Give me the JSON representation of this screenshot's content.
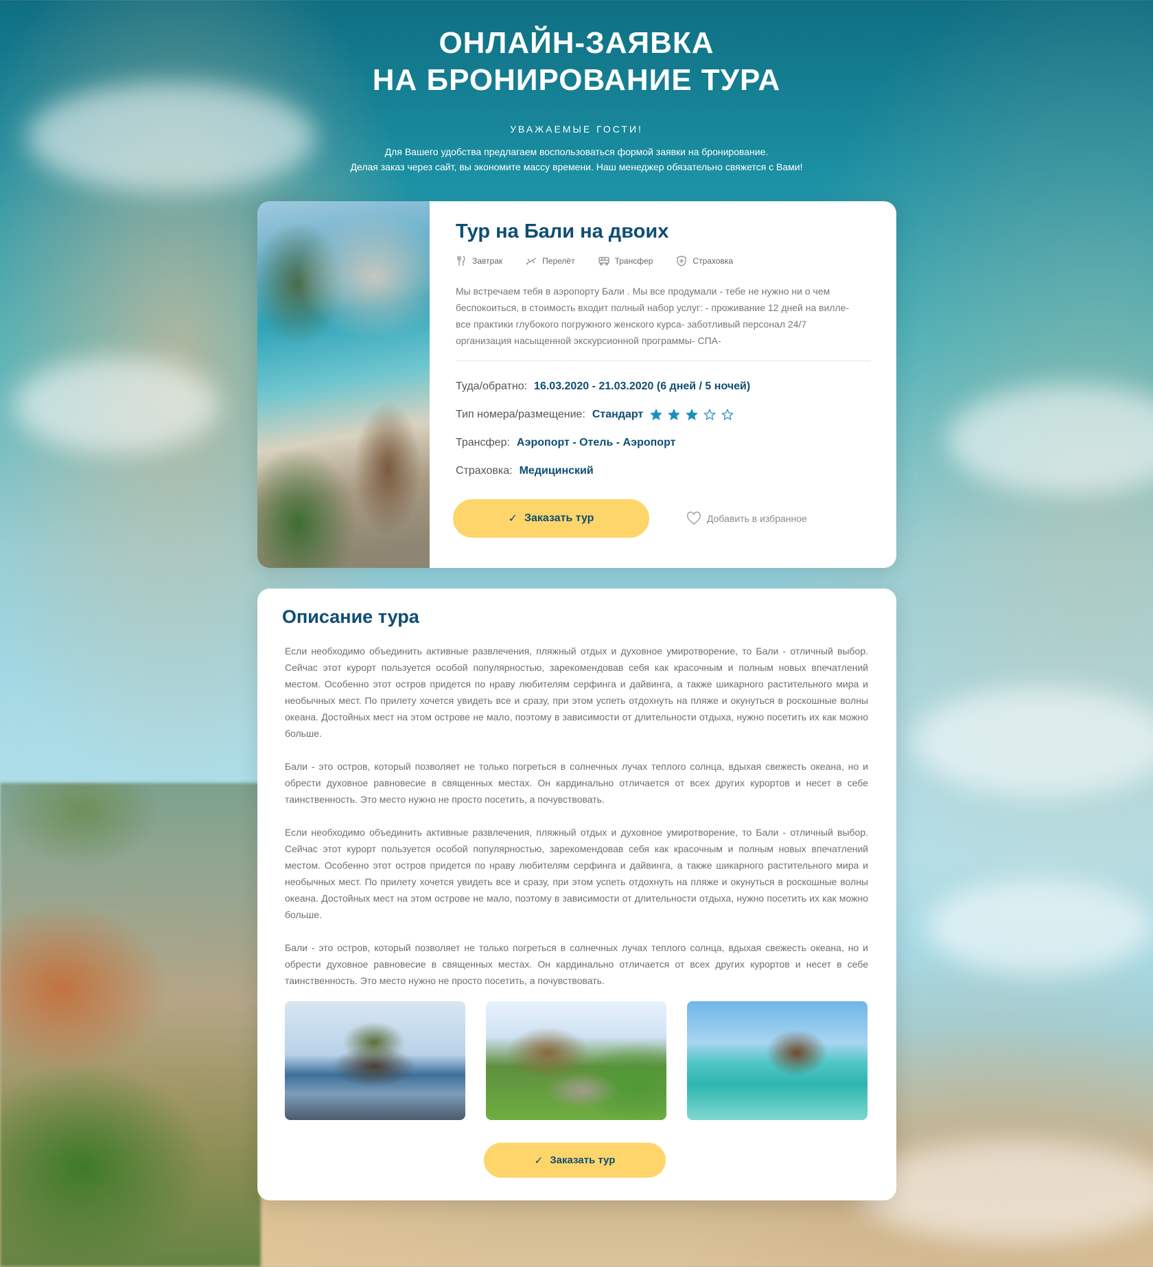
{
  "header": {
    "title": "ОНЛАЙН-ЗАЯВКА\nНА БРОНИРОВАНИЕ ТУРА",
    "subtitle": "УВАЖАЕМЫЕ ГОСТИ!",
    "intro_line1": "Для Вашего удобства предлагаем воспользоваться формой заявки на бронирование.",
    "intro_line2": "Делая заказ через сайт, вы экономите массу  времени. Наш менеджер обязательно свяжется с Вами!"
  },
  "tour": {
    "title": "Тур на Бали на двоих",
    "features": [
      {
        "icon": "breakfast-icon",
        "label": "Завтрак"
      },
      {
        "icon": "plane-icon",
        "label": "Перелёт"
      },
      {
        "icon": "bus-icon",
        "label": "Трансфер"
      },
      {
        "icon": "shield-icon",
        "label": "Страховка"
      }
    ],
    "description": "Мы встречаем тебя в аэропорту Бали . Мы все продумали - тебе не нужно ни о чем беспокоиться, в стоимость входит полный набор услуг: - проживание 12 дней на вилле- все практики глубокого погружного женского курса- заботливый персонал 24/7 организация насыщенной экскурсионной программы- СПА-",
    "dates_label": "Туда/обратно:",
    "dates_value": "16.03.2020 - 21.03.2020 (6 дней / 5 ночей)",
    "room_label": "Тип номера/размещение:",
    "room_value": "Стандарт",
    "rating": 3,
    "rating_max": 5,
    "transfer_label": "Трансфер:",
    "transfer_value": "Аэропорт - Отель - Аэропорт",
    "insurance_label": "Страховка:",
    "insurance_value": "Медицинский",
    "order_label": "Заказать тур",
    "favorite_label": "Добавить в избранное"
  },
  "description": {
    "title": "Описание тура",
    "paragraphs": [
      "Если необходимо объединить активные развлечения, пляжный отдых и духовное умиротворение, то Бали - отличный выбор. Сейчас этот курорт пользуется особой популярностью, зарекомендовав себя как красочным и полным новых впечатлений местом. Особенно этот остров придется по нраву любителям серфинга и дайвинга, а также шикарного растительного мира и необычных мест. По прилету хочется увидеть все и сразу, при этом успеть отдохнуть на пляже и окунуться в роскошные волны океана. Достойных мест на этом острове не мало, поэтому в зависимости от длительности отдыха, нужно посетить их как можно больше.",
      "Бали - это остров, который позволяет не только погреться в солнечных лучах теплого солнца, вдыхая свежесть океана, но и обрести духовное равновесие в священных местах. Он кардинально отличается от всех других курортов и несет в себе таинственность. Это место нужно не просто посетить, а почувствовать.",
      "Если необходимо объединить активные развлечения, пляжный отдых и духовное умиротворение, то Бали - отличный выбор. Сейчас этот курорт пользуется особой популярностью, зарекомендовав себя как красочным и полным новых впечатлений местом. Особенно этот остров придется по нраву любителям серфинга и дайвинга, а также шикарного растительного мира и необычных мест. По прилету хочется увидеть все и сразу, при этом успеть отдохнуть на пляже и окунуться в роскошные волны океана. Достойных мест на этом острове не мало, поэтому в зависимости от длительности отдыха, нужно посетить их как можно больше.",
      "Бали - это остров, который позволяет не только погреться в солнечных лучах теплого солнца, вдыхая свежесть океана, но и обрести духовное равновесие в священных местах. Он кардинально отличается от всех других курортов и несет в себе таинственность. Это место нужно не просто посетить, а почувствовать."
    ],
    "order_label": "Заказать тур"
  },
  "colors": {
    "accent_yellow": "#fed56b",
    "title_blue": "#0e4d73",
    "star_blue": "#1a8fbf"
  }
}
